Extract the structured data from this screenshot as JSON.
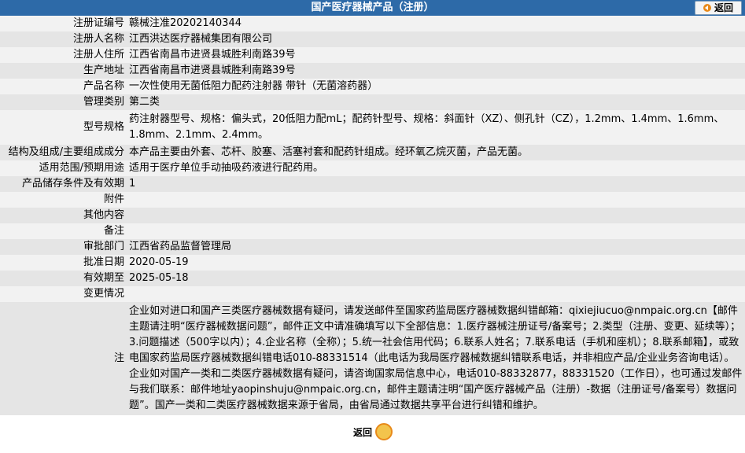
{
  "header": {
    "title": "国产医疗器械产品（注册）",
    "return_label": "返回"
  },
  "rows": [
    {
      "label": "注册证编号",
      "value": "赣械注准20202140344"
    },
    {
      "label": "注册人名称",
      "value": "江西洪达医疗器械集团有限公司"
    },
    {
      "label": "注册人住所",
      "value": "江西省南昌市进贤县城胜利南路39号"
    },
    {
      "label": "生产地址",
      "value": "江西省南昌市进贤县城胜利南路39号"
    },
    {
      "label": "产品名称",
      "value": "一次性使用无菌低阻力配药注射器 带针（无菌溶药器）"
    },
    {
      "label": "管理类别",
      "value": "第二类"
    },
    {
      "label": "型号规格",
      "value": "药注射器型号、规格：偏头式，20低阻力配mL；配药针型号、规格：斜面针（XZ）、侧孔针（CZ），1.2mm、1.4mm、1.6mm、1.8mm、2.1mm、2.4mm。"
    },
    {
      "label": "结构及组成/主要组成成分",
      "value": "本产品主要由外套、芯杆、胶塞、活塞衬套和配药针组成。经环氧乙烷灭菌，产品无菌。"
    },
    {
      "label": "适用范围/预期用途",
      "value": "适用于医疗单位手动抽吸药液进行配药用。"
    },
    {
      "label": "产品储存条件及有效期",
      "value": "1"
    },
    {
      "label": "附件",
      "value": ""
    },
    {
      "label": "其他内容",
      "value": ""
    },
    {
      "label": "备注",
      "value": ""
    },
    {
      "label": "审批部门",
      "value": "江西省药品监督管理局"
    },
    {
      "label": "批准日期",
      "value": "2020-05-19"
    },
    {
      "label": "有效期至",
      "value": "2025-05-18"
    },
    {
      "label": "变更情况",
      "value": ""
    }
  ],
  "note": {
    "label": "注",
    "text": "企业如对进口和国产三类医疗器械数据有疑问，请发送邮件至国家药监局医疗器械数据纠错邮箱：qixiejiucuo@nmpaic.org.cn【邮件主题请注明“医疗器械数据问题”，邮件正文中请准确填写以下全部信息：1.医疗器械注册证号/备案号；2.类型（注册、变更、延续等）；3.问题描述（500字以内）；4.企业名称（全称）；5.统一社会信用代码；6.联系人姓名；7.联系电话（手机和座机）；8.联系邮箱】，或致电国家药监局医疗器械数据纠错电话010-88331514（此电话为我局医疗器械数据纠错联系电话，并非相应产品/企业业务咨询电话）。企业如对国产一类和二类医疗器械数据有疑问，请咨询国家局信息中心，电话010-88332877，88331520（工作日），也可通过发邮件与我们联系：邮件地址yaopinshuju@nmpaic.org.cn，邮件主题请注明“国产医疗器械产品（注册）-数据（注册证号/备案号）数据问题”。国产一类和二类医疗器械数据来源于省局，由省局通过数据共享平台进行纠错和维护。"
  },
  "footer": {
    "return_label": "返回"
  }
}
